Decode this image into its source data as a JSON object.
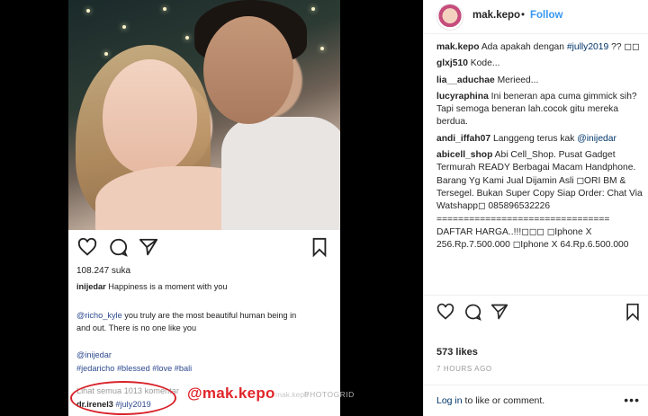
{
  "post_card": {
    "likes": "108.247 suka",
    "caption_user": "inijedar",
    "caption_text": "Happiness is a moment with you",
    "mention_user": "@richo_kyle",
    "mention_text_1": "you truly are the most beautiful human being in",
    "mention_text_2": "and out. There is no one like you",
    "mention_self": "@inijedar",
    "hashtags": "#jedaricho #blessed #love #bali",
    "view_comments": "Lihat semua 1013 komentar",
    "first_comment_user": "dr.irenel3",
    "first_comment_tag": "#july2019",
    "watermark": "@mak.kepo",
    "watermark_ghost": "mak.kepo",
    "photogrid": "PHOTOGRID"
  },
  "header": {
    "username": "mak.kepo",
    "separator": "•",
    "follow_label": "Follow"
  },
  "comments": [
    {
      "user": "mak.kepo",
      "text": "Ada apakah dengan ",
      "tag": "#jully2019",
      "after": " ?? ◻◻"
    },
    {
      "user": "glxj510",
      "text": "Kode...",
      "tag": "",
      "after": ""
    },
    {
      "user": "lia__aduchae",
      "text": "Merieed...",
      "tag": "",
      "after": ""
    },
    {
      "user": "lucyraphina",
      "text": "Ini beneran apa cuma gimmick sih? Tapi semoga beneran lah.cocok gitu mereka berdua.",
      "tag": "",
      "after": ""
    },
    {
      "user": "andi_iffah07",
      "text": "Langgeng terus kak ",
      "tag": "@inijedar",
      "after": ""
    },
    {
      "user": "abicell_shop",
      "text": "Abi Cell_Shop. Pusat Gadget Termurah READY Berbagai Macam Handphone. Barang Yg Kami Jual Dijamin Asli ◻ORI BM & Tersegel. Bukan Super Copy Siap Order: Chat Via Watshapp◻ 085896532226 ================================ DAFTAR HARGA..!!!◻◻◻ ◻Iphone X 256.Rp.7.500.000 ◻Iphone X 64.Rp.6.500.000",
      "tag": "",
      "after": ""
    }
  ],
  "post_meta": {
    "likes": "573 likes",
    "time": "7 HOURS AGO",
    "login_link": "Log in",
    "login_text": " to like or comment.",
    "more": "•••"
  }
}
